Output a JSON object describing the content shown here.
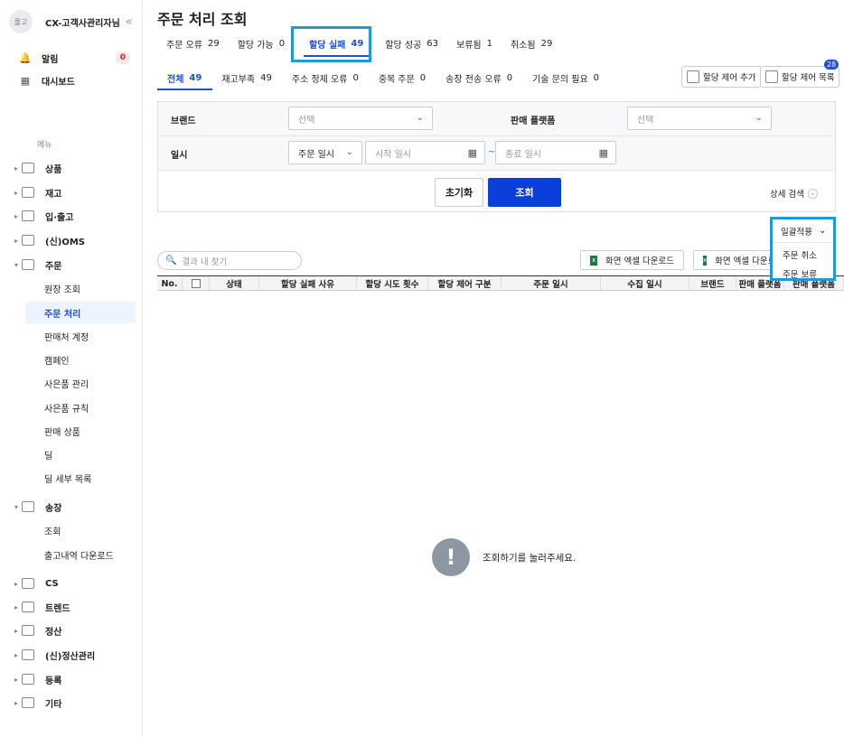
{
  "sidebar": {
    "avatar": "풀고",
    "title": "CX-고객사관리자님",
    "collapse_icon": "«",
    "alerts_label": "알림",
    "alerts_count": "0",
    "dashboard_label": "대시보드",
    "menu_label": "메뉴",
    "items": [
      {
        "label": "상품"
      },
      {
        "label": "재고"
      },
      {
        "label": "입·출고"
      },
      {
        "label": "(신)OMS"
      },
      {
        "label": "주문"
      },
      {
        "label": "송장"
      },
      {
        "label": "CS"
      },
      {
        "label": "트렌드"
      },
      {
        "label": "정산"
      },
      {
        "label": "(신)정산관리"
      },
      {
        "label": "등록"
      },
      {
        "label": "기타"
      }
    ],
    "order_sub": [
      "원장 조회",
      "주문 처리",
      "판매처 계정",
      "캠페인",
      "사은품 관리",
      "사은품 규칙",
      "판매 상품",
      "딜",
      "딜 세부 목록"
    ],
    "invoice_sub": [
      "조회",
      "출고내역 다운로드"
    ]
  },
  "main": {
    "title": "주문 처리 조회",
    "tabs": [
      {
        "label": "주문 오류",
        "count": "29"
      },
      {
        "label": "할당 가능",
        "count": "0"
      },
      {
        "label": "할당 실패",
        "count": "49"
      },
      {
        "label": "할당 성공",
        "count": "63"
      },
      {
        "label": "보류됨",
        "count": "1"
      },
      {
        "label": "취소됨",
        "count": "29"
      }
    ],
    "subtabs": [
      {
        "label": "전체",
        "count": "49"
      },
      {
        "label": "재고부족",
        "count": "49"
      },
      {
        "label": "주소 정제 오류",
        "count": "0"
      },
      {
        "label": "중복 주문",
        "count": "0"
      },
      {
        "label": "송장 전송 오류",
        "count": "0"
      },
      {
        "label": "기술 문의 필요",
        "count": "0"
      }
    ],
    "btn_add_exclusion": "할당 제어 추가",
    "btn_exclusion_list": "할당 제어 목록",
    "exclusion_count": "28"
  },
  "filter": {
    "brand_label": "브랜드",
    "brand_placeholder": "선택",
    "platform_label": "판매 플랫폼",
    "platform_placeholder": "선택",
    "date_label": "일시",
    "date_type": "주문 일시",
    "start_placeholder": "시작 일시",
    "tilde": "~",
    "end_placeholder": "종료 일시",
    "reset": "초기화",
    "search": "조회",
    "advanced": "상세 검색"
  },
  "batch": {
    "label": "일괄적용",
    "options": [
      "주문 취소",
      "주문 보류"
    ]
  },
  "results": {
    "search_placeholder": "결과 내 찾기",
    "excel1": "화면 엑셀 다운로드",
    "excel2": "화면 엑셀 다운로드",
    "columns": [
      "No.",
      "",
      "상태",
      "할당 실패 사유",
      "할당 시도 횟수",
      "할당 제어 구분",
      "주문 일시",
      "수집 일시",
      "브랜드",
      "판매 플랫폼",
      "판매 플랫폼"
    ],
    "empty_message": "조회하기를 눌러주세요."
  }
}
